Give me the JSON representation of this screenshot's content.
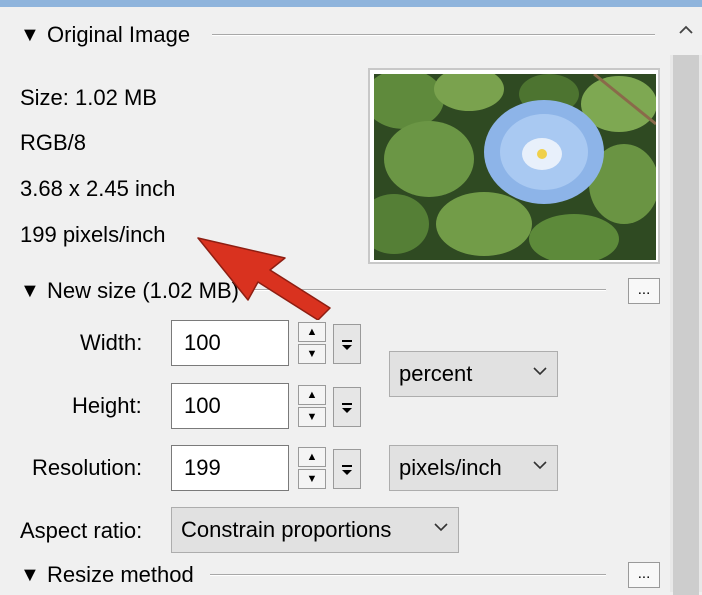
{
  "original": {
    "header": "Original Image",
    "size": "Size: 1.02 MB",
    "mode": "RGB/8",
    "dimensions": "3.68 x 2.45 inch",
    "resolution": "199 pixels/inch"
  },
  "new_size": {
    "header": "New size (1.02 MB)",
    "more_label": "...",
    "width_label": "Width:",
    "width_value": "100",
    "height_label": "Height:",
    "height_value": "100",
    "resolution_label": "Resolution:",
    "resolution_value": "199",
    "unit_select": "percent",
    "res_unit_select": "pixels/inch",
    "aspect_label": "Aspect ratio:",
    "aspect_select": "Constrain proportions"
  },
  "resize_method": {
    "header": "Resize method",
    "more_label": "..."
  },
  "colors": {
    "annotation_arrow": "#d9321f",
    "accent_topline": "#8fb4dc"
  }
}
